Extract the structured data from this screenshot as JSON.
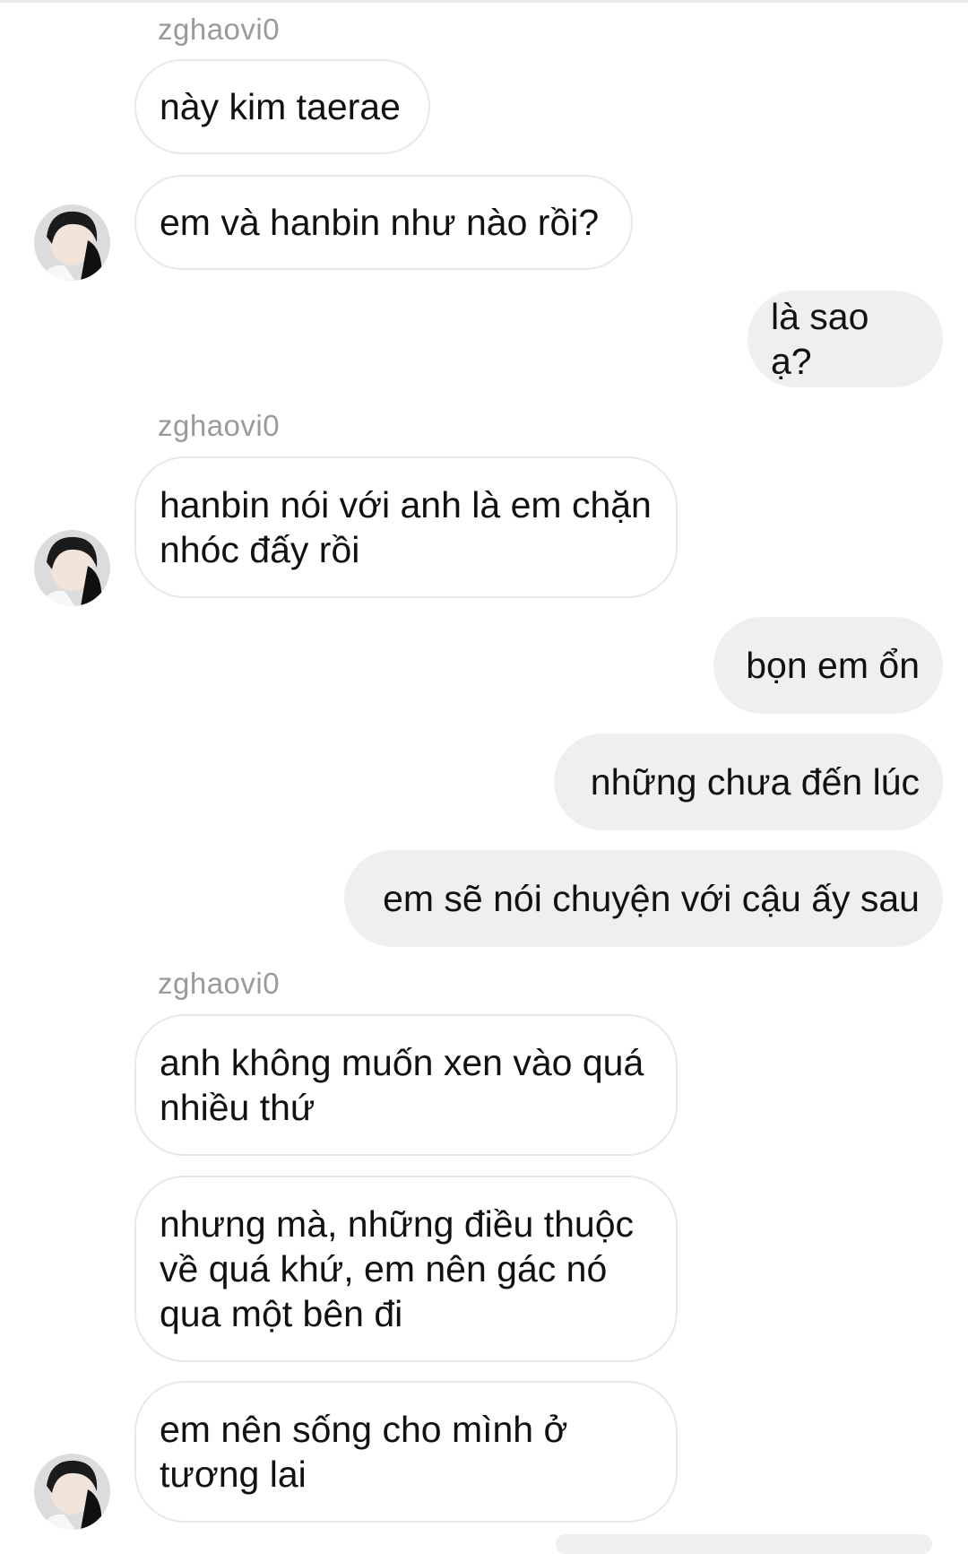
{
  "conversation": {
    "sender_name": "zghaovi0",
    "messages": [
      {
        "from": "them",
        "text": "này kim taerae"
      },
      {
        "from": "them",
        "text": "em và hanbin như nào rồi?"
      },
      {
        "from": "me",
        "text": "là sao ạ?"
      },
      {
        "from": "them",
        "text": "hanbin nói với anh là em chặn nhóc đấy rồi"
      },
      {
        "from": "me",
        "text": "bọn em ổn"
      },
      {
        "from": "me",
        "text": "những chưa đến lúc"
      },
      {
        "from": "me",
        "text": "em sẽ nói chuyện với cậu ấy sau"
      },
      {
        "from": "them",
        "text": "anh không muốn xen vào quá nhiều thứ"
      },
      {
        "from": "them",
        "text": "nhưng mà, những điều thuộc về quá khứ, em nên gác nó qua một bên đi"
      },
      {
        "from": "them",
        "text": "em nên sống cho mình ở tương lai"
      }
    ]
  },
  "colors": {
    "incoming_bubble_bg": "#ffffff",
    "incoming_bubble_border": "#e8e8e8",
    "outgoing_bubble_bg": "#efefef",
    "sender_name": "#9a9a9a",
    "text": "#111111"
  }
}
